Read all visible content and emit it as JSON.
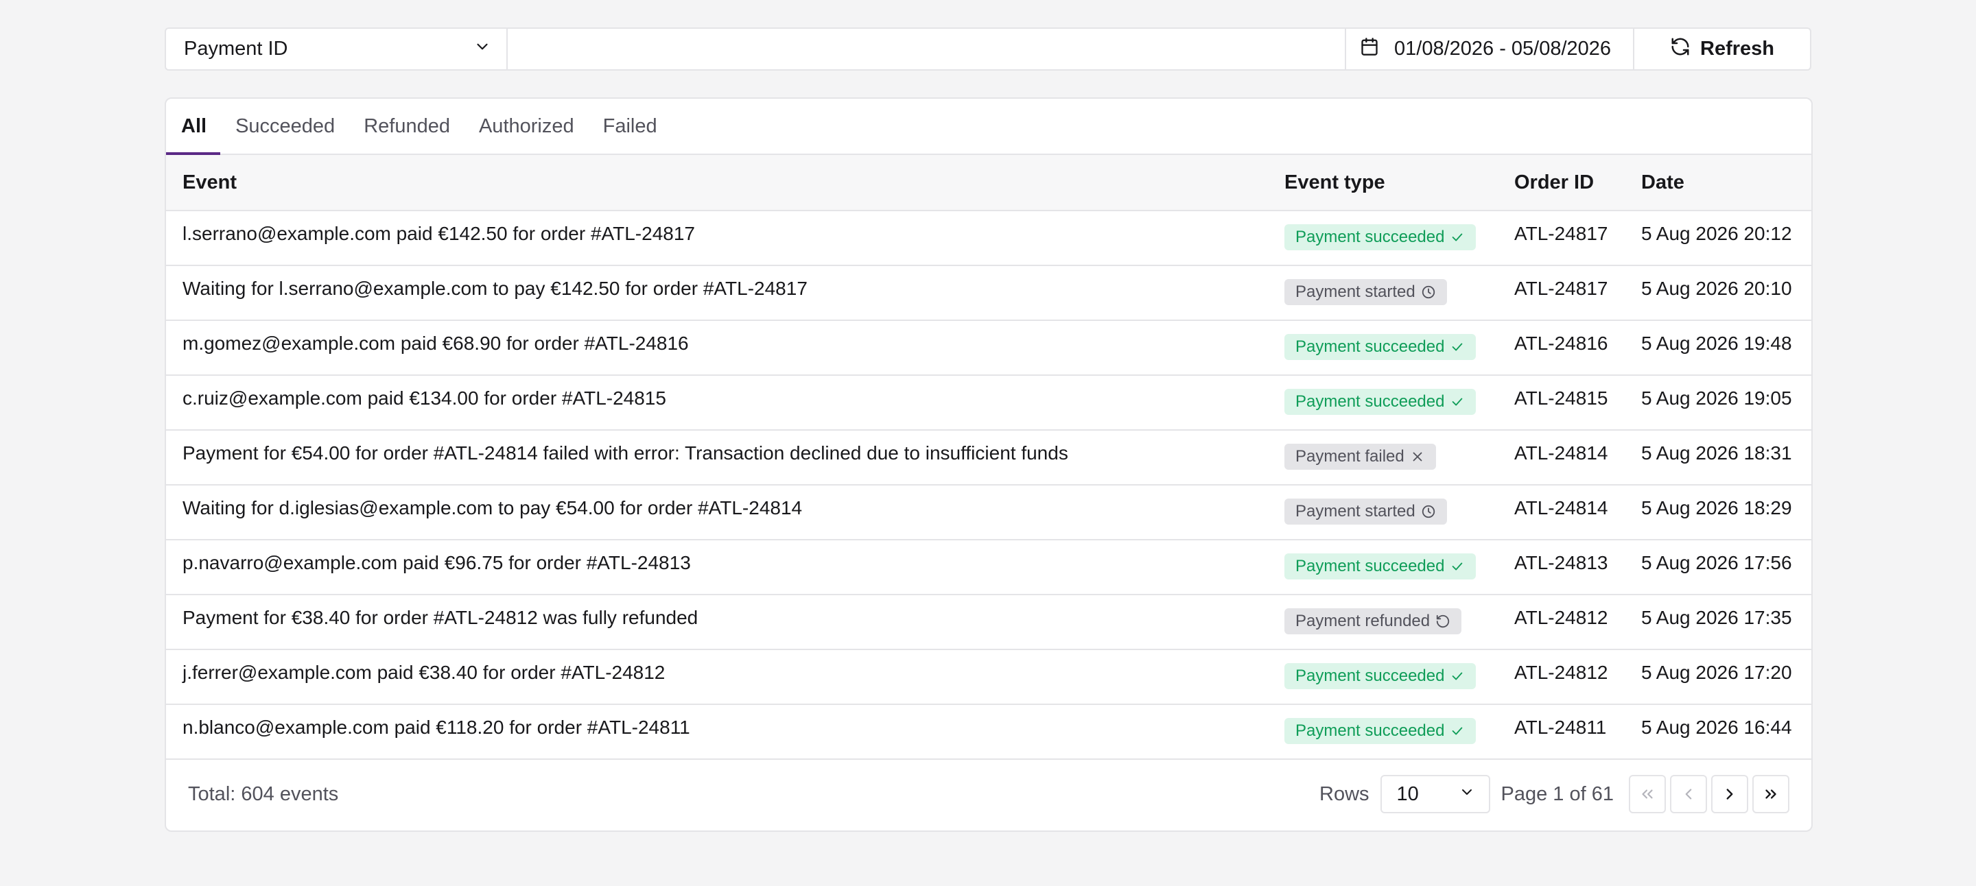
{
  "filter": {
    "field_label": "Payment ID",
    "search_value": "",
    "date_range": "01/08/2026 - 05/08/2026",
    "refresh_label": "Refresh"
  },
  "tabs": [
    {
      "label": "All",
      "active": true
    },
    {
      "label": "Succeeded",
      "active": false
    },
    {
      "label": "Refunded",
      "active": false
    },
    {
      "label": "Authorized",
      "active": false
    },
    {
      "label": "Failed",
      "active": false
    }
  ],
  "table": {
    "headers": {
      "event": "Event",
      "type": "Event type",
      "order": "Order ID",
      "date": "Date"
    },
    "rows": [
      {
        "event": "l.serrano@example.com paid €142.50 for order #ATL-24817",
        "type": "Payment succeeded",
        "status": "success",
        "icon": "check-icon",
        "order": "ATL-24817",
        "date": "5 Aug 2026 20:12"
      },
      {
        "event": "Waiting for l.serrano@example.com to pay €142.50 for order #ATL-24817",
        "type": "Payment started",
        "status": "neutral",
        "icon": "clock-icon",
        "order": "ATL-24817",
        "date": "5 Aug 2026 20:10"
      },
      {
        "event": "m.gomez@example.com paid €68.90 for order #ATL-24816",
        "type": "Payment succeeded",
        "status": "success",
        "icon": "check-icon",
        "order": "ATL-24816",
        "date": "5 Aug 2026 19:48"
      },
      {
        "event": "c.ruiz@example.com paid €134.00 for order #ATL-24815",
        "type": "Payment succeeded",
        "status": "success",
        "icon": "check-icon",
        "order": "ATL-24815",
        "date": "5 Aug 2026 19:05"
      },
      {
        "event": "Payment for €54.00 for order #ATL-24814 failed with error: Transaction declined due to insufficient funds",
        "type": "Payment failed",
        "status": "neutral",
        "icon": "x-icon",
        "order": "ATL-24814",
        "date": "5 Aug 2026 18:31"
      },
      {
        "event": "Waiting for d.iglesias@example.com to pay €54.00 for order #ATL-24814",
        "type": "Payment started",
        "status": "neutral",
        "icon": "clock-icon",
        "order": "ATL-24814",
        "date": "5 Aug 2026 18:29"
      },
      {
        "event": "p.navarro@example.com paid €96.75 for order #ATL-24813",
        "type": "Payment succeeded",
        "status": "success",
        "icon": "check-icon",
        "order": "ATL-24813",
        "date": "5 Aug 2026 17:56"
      },
      {
        "event": "Payment for €38.40 for order #ATL-24812 was fully refunded",
        "type": "Payment refunded",
        "status": "neutral",
        "icon": "refund-icon",
        "order": "ATL-24812",
        "date": "5 Aug 2026 17:35"
      },
      {
        "event": "j.ferrer@example.com paid €38.40 for order #ATL-24812",
        "type": "Payment succeeded",
        "status": "success",
        "icon": "check-icon",
        "order": "ATL-24812",
        "date": "5 Aug 2026 17:20"
      },
      {
        "event": "n.blanco@example.com paid €118.20 for order #ATL-24811",
        "type": "Payment succeeded",
        "status": "success",
        "icon": "check-icon",
        "order": "ATL-24811",
        "date": "5 Aug 2026 16:44"
      }
    ]
  },
  "footer": {
    "total": "Total: 604 events",
    "rows_label": "Rows",
    "rows_value": "10",
    "page_info": "Page 1 of 61"
  },
  "colors": {
    "accent": "#5b2a86",
    "success_bg": "#dcf5e9",
    "success_text": "#0f9d58",
    "neutral_bg": "#e4e4e7",
    "neutral_text": "#52525b"
  }
}
